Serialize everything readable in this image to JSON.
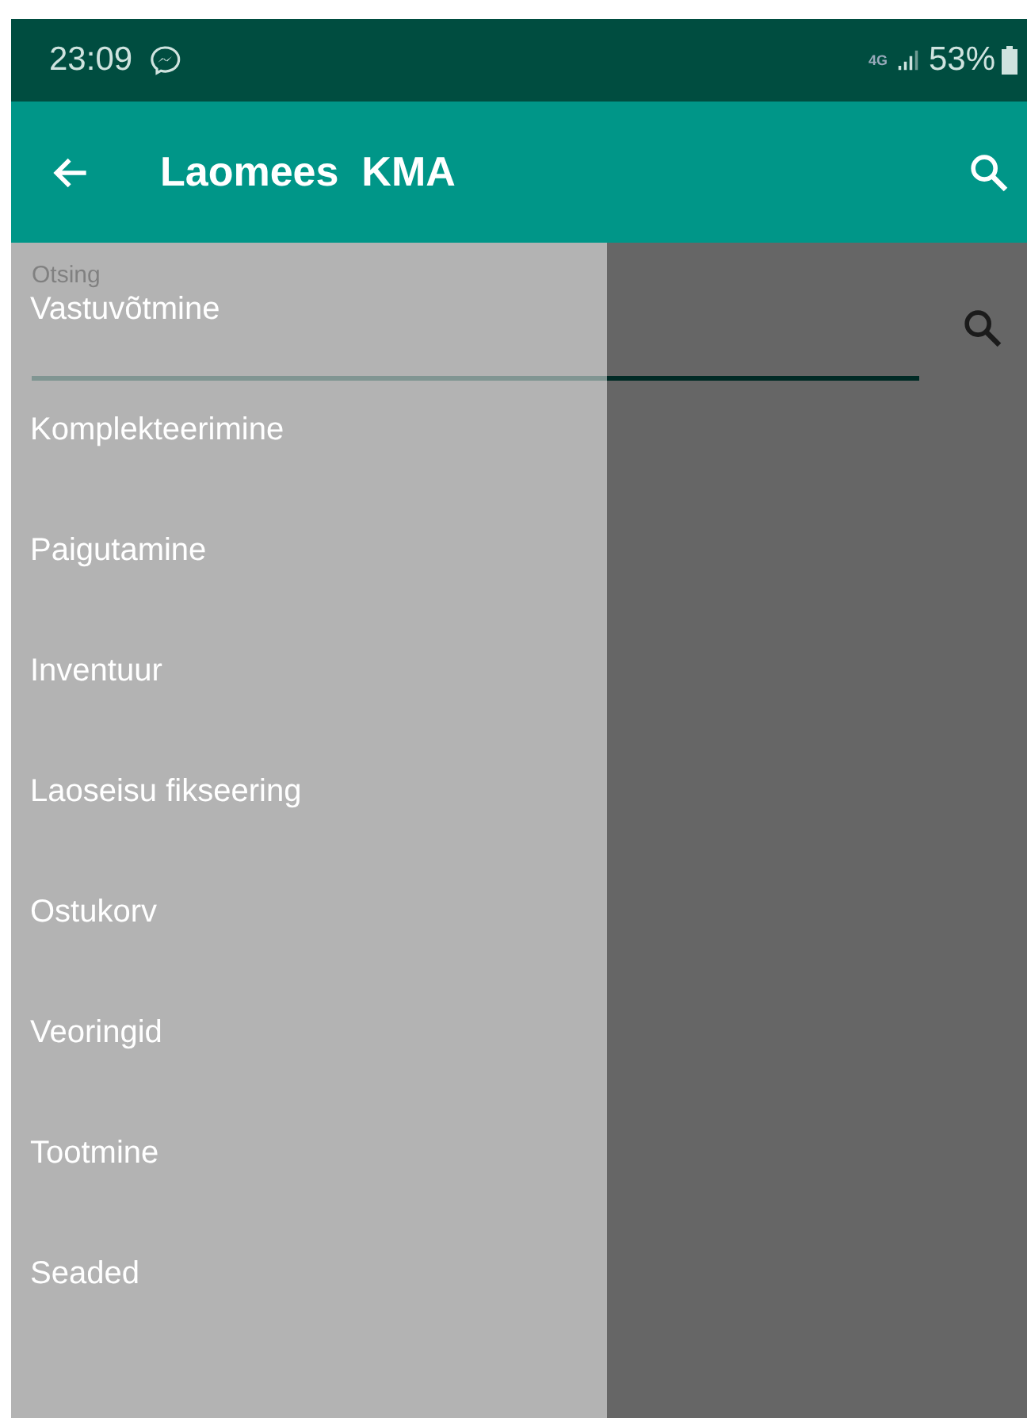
{
  "status_bar": {
    "time": "23:09",
    "network": "4G",
    "battery": "53%"
  },
  "app_bar": {
    "title": "Laomees  KMA"
  },
  "search": {
    "placeholder": "Otsing"
  },
  "drawer": {
    "items": [
      {
        "label": "Vastuvõtmine"
      },
      {
        "label": "Komplekteerimine"
      },
      {
        "label": "Paigutamine"
      },
      {
        "label": "Inventuur"
      },
      {
        "label": "Laoseisu fikseering"
      },
      {
        "label": "Ostukorv"
      },
      {
        "label": "Veoringid"
      },
      {
        "label": "Tootmine"
      },
      {
        "label": "Seaded"
      }
    ]
  }
}
